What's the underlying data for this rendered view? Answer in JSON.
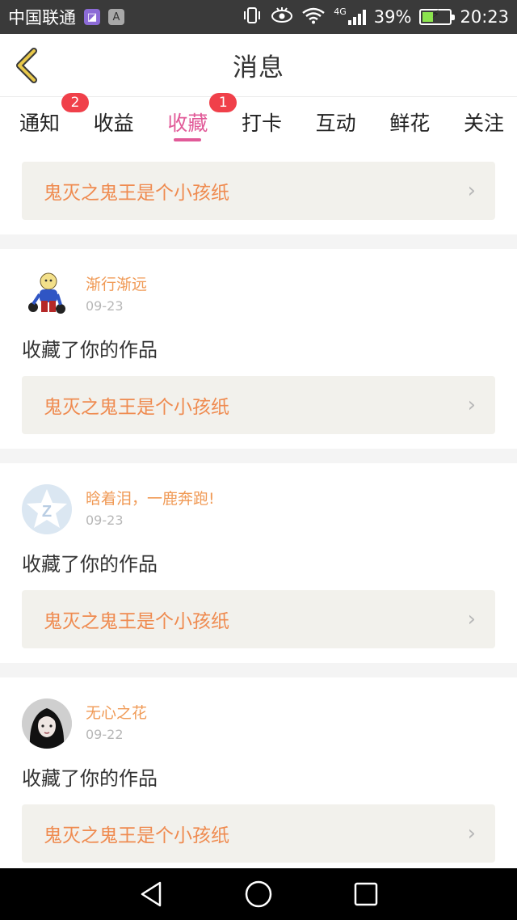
{
  "status_bar": {
    "carrier": "中国联通",
    "app_icon_1": "gallery-app-icon",
    "app_icon_1_glyph": "◪",
    "app_icon_2": "font-app-icon",
    "app_icon_2_glyph": "A",
    "network": "4G",
    "battery_text": "39%",
    "battery_level": 0.39,
    "time": "20:23"
  },
  "header": {
    "title": "消息",
    "back_icon": "chevron-left-icon"
  },
  "tabs": [
    {
      "label": "通知",
      "badge": "2",
      "active": false
    },
    {
      "label": "收益",
      "badge": "",
      "active": false
    },
    {
      "label": "收藏",
      "badge": "1",
      "active": true
    },
    {
      "label": "打卡",
      "badge": "",
      "active": false
    },
    {
      "label": "互动",
      "badge": "",
      "active": false
    },
    {
      "label": "鲜花",
      "badge": "",
      "active": false
    },
    {
      "label": "关注",
      "badge": "",
      "active": false
    }
  ],
  "first_card": {
    "work_title": "鬼灭之鬼王是个小孩纸",
    "chevron": "›"
  },
  "entries": [
    {
      "avatar": "cartoon-character-avatar",
      "user_name": "渐行渐远",
      "date": "09-23",
      "action": "收藏了你的作品",
      "work_title": "鬼灭之鬼王是个小孩纸",
      "chevron": "›"
    },
    {
      "avatar": "qq-default-avatar",
      "user_name": "晗着泪，一鹿奔跑!",
      "date": "09-23",
      "action": "收藏了你的作品",
      "work_title": "鬼灭之鬼王是个小孩纸",
      "chevron": "›"
    },
    {
      "avatar": "dark-hair-girl-avatar",
      "user_name": "无心之花",
      "date": "09-22",
      "action": "收藏了你的作品",
      "work_title": "鬼灭之鬼王是个小孩纸",
      "chevron": "›"
    }
  ],
  "colors": {
    "accent_pink": "#e15a98",
    "badge_red": "#f0404a",
    "username_orange": "#f09a56",
    "work_title_orange": "#ef8b50",
    "link_bg": "#f2f1ec",
    "back_arrow": "#c9a832"
  },
  "nav": {
    "back": "triangle-back-icon",
    "home": "circle-home-icon",
    "recents": "square-recents-icon"
  }
}
